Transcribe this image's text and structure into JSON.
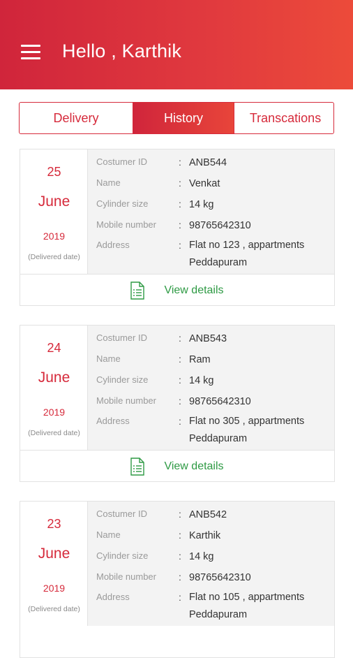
{
  "header": {
    "greeting": "Hello , Karthik",
    "menu_icon": "menu-icon"
  },
  "tabs": [
    {
      "label": "Delivery",
      "active": false
    },
    {
      "label": "History",
      "active": true
    },
    {
      "label": "Transcations",
      "active": false
    }
  ],
  "labels": {
    "customer_id": "Costumer ID",
    "name": "Name",
    "cylinder_size": "Cylinder size",
    "mobile": "Mobile number",
    "address": "Address",
    "colon": ":",
    "delivered_date": "(Delivered date)",
    "view_details": "View details"
  },
  "orders": [
    {
      "day": "25",
      "month": "June",
      "year": "2019",
      "customer_id": "ANB544",
      "name": "Venkat",
      "cylinder_size": "14 kg",
      "mobile": "98765642310",
      "address_line1": "Flat no 123 , appartments",
      "address_line2": "Peddapuram"
    },
    {
      "day": "24",
      "month": "June",
      "year": "2019",
      "customer_id": "ANB543",
      "name": "Ram",
      "cylinder_size": "14 kg",
      "mobile": "98765642310",
      "address_line1": "Flat no 305 , appartments",
      "address_line2": "Peddapuram"
    },
    {
      "day": "23",
      "month": "June",
      "year": "2019",
      "customer_id": "ANB542",
      "name": "Karthik",
      "cylinder_size": "14 kg",
      "mobile": "98765642310",
      "address_line1": "Flat no 105 , appartments",
      "address_line2": "Peddapuram"
    }
  ],
  "colors": {
    "accent": "#d62a3b",
    "link_green": "#2e9a44",
    "panel_bg": "#f3f3f3"
  }
}
